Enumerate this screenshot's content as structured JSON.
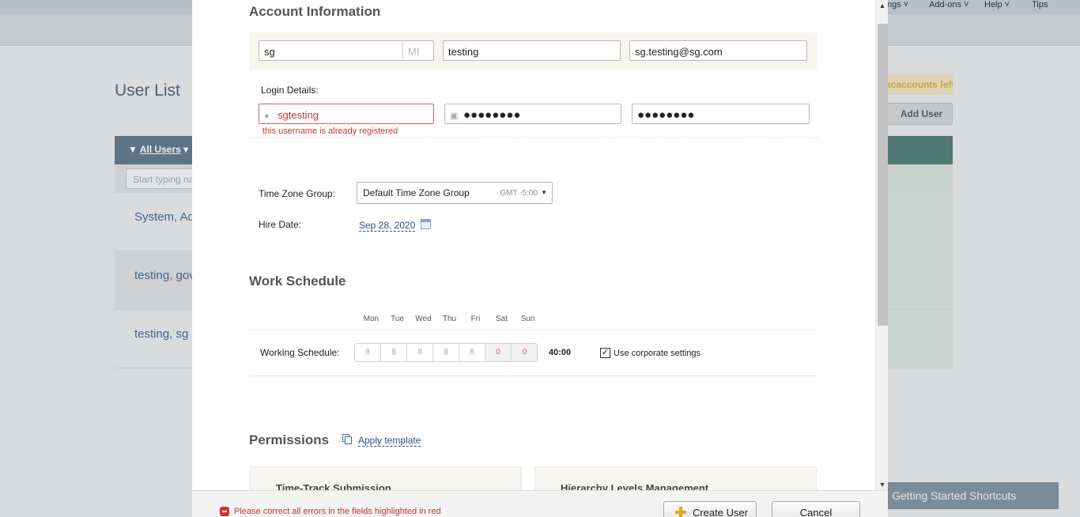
{
  "background": {
    "nav": {
      "settings": "Settings",
      "addons": "Add-ons",
      "help": "Help",
      "tips": "Tips"
    },
    "page_title": "User List",
    "filter_label": "All Users",
    "search_placeholder": "Start typing name",
    "rows": [
      "System, Administrator",
      "testing, gov",
      "testing, sg"
    ],
    "accounts_left": "accounts left",
    "add_user": "Add User",
    "shortcuts": "Getting Started Shortcuts"
  },
  "modal": {
    "account": {
      "title": "Account Information",
      "first_name": "sg",
      "mi_placeholder": "MI",
      "last_name": "testing",
      "email": "sg.testing@sg.com"
    },
    "login": {
      "label": "Login Details:",
      "username": "sgtesting",
      "password": "●●●●●●●●",
      "password_confirm": "●●●●●●●●",
      "error": "this username is already registered"
    },
    "timezone": {
      "label": "Time Zone Group:",
      "value": "Default Time Zone Group",
      "gmt": "GMT -5:00"
    },
    "hire": {
      "label": "Hire Date:",
      "value": "Sep 28, 2020"
    },
    "schedule": {
      "title": "Work Schedule",
      "label": "Working Schedule:",
      "days": [
        "Mon",
        "Tue",
        "Wed",
        "Thu",
        "Fri",
        "Sat",
        "Sun"
      ],
      "hours": [
        "8",
        "8",
        "8",
        "8",
        "8",
        "0",
        "0"
      ],
      "total": "40:00",
      "corporate_label": "Use corporate settings",
      "corporate_checked": true
    },
    "permissions": {
      "title": "Permissions",
      "apply_template": "Apply template",
      "cards": [
        "Time-Track Submission",
        "Hierarchy Levels Management"
      ]
    },
    "footer": {
      "error": "Please correct all errors in the fields highlighted in red",
      "create": "Create User",
      "cancel": "Cancel"
    }
  },
  "colors": {
    "error": "#c0392b",
    "link": "#2b4f8a",
    "table_header": "#5d7388"
  }
}
